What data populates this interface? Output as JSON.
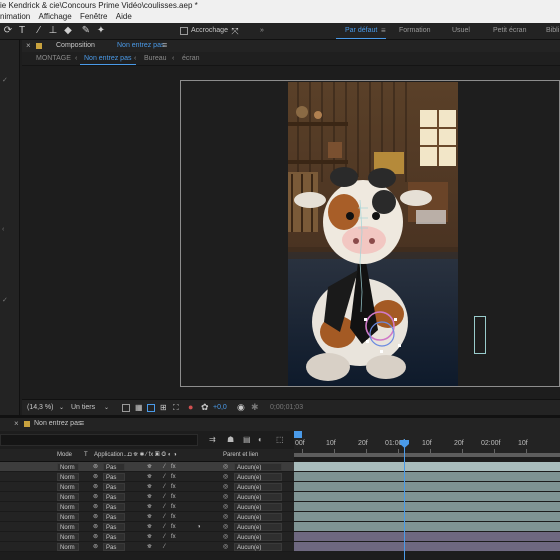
{
  "window": {
    "title": "ie Kendrick & cie\\Concours Prime Vidéo\\coulisses.aep *"
  },
  "menu": [
    "nimation",
    "Affichage",
    "Fenêtre",
    "Aide"
  ],
  "toolbar": {
    "snap_label": "Accrochage",
    "workspaces": [
      "Par défaut",
      "Formation",
      "Usuel",
      "Petit écran",
      "Bibli"
    ],
    "active_workspace": "Par défaut"
  },
  "composition": {
    "panel_label": "Composition",
    "name": "Non entrez pas",
    "breadcrumbs": [
      "MONTAGE",
      "Non entrez pas",
      "Bureau",
      "écran"
    ]
  },
  "viewer": {
    "zoom": "(14,3 %)",
    "resolution": "Un tiers",
    "exposure": "+0,0",
    "timecode": "0;00;01;03"
  },
  "timeline": {
    "tab_name": "Non entrez pas",
    "columns": {
      "mode": "Mode",
      "t": "T",
      "matte": "Application...",
      "parent": "Parent et lien"
    },
    "ruler": [
      "00f",
      "10f",
      "20f",
      "01:00f",
      "10f",
      "20f",
      "02:00f",
      "10f"
    ],
    "layers": [
      {
        "mode": "Norm",
        "matte": "Pas",
        "parent": "Aucun(e)",
        "selected": true
      },
      {
        "mode": "Norm",
        "matte": "Pas",
        "parent": "Aucun(e)",
        "selected": false
      },
      {
        "mode": "Norm",
        "matte": "Pas",
        "parent": "Aucun(e)",
        "selected": false
      },
      {
        "mode": "Norm",
        "matte": "Pas",
        "parent": "Aucun(e)",
        "selected": false
      },
      {
        "mode": "Norm",
        "matte": "Pas",
        "parent": "Aucun(e)",
        "selected": false
      },
      {
        "mode": "Norm",
        "matte": "Pas",
        "parent": "Aucun(e)",
        "selected": false
      },
      {
        "mode": "Norm",
        "matte": "Pas",
        "parent": "Aucun(e)",
        "selected": false
      },
      {
        "mode": "Norm",
        "matte": "Pas",
        "parent": "Aucun(e)",
        "selected": false
      },
      {
        "mode": "Norm",
        "matte": "Pas",
        "parent": "Aucun(e)",
        "selected": false
      }
    ]
  },
  "colors": {
    "accent": "#4a9ae8",
    "label_yellow": "#c8a23e",
    "track_teal": "#7e9393",
    "track_purple": "#6e6880"
  }
}
